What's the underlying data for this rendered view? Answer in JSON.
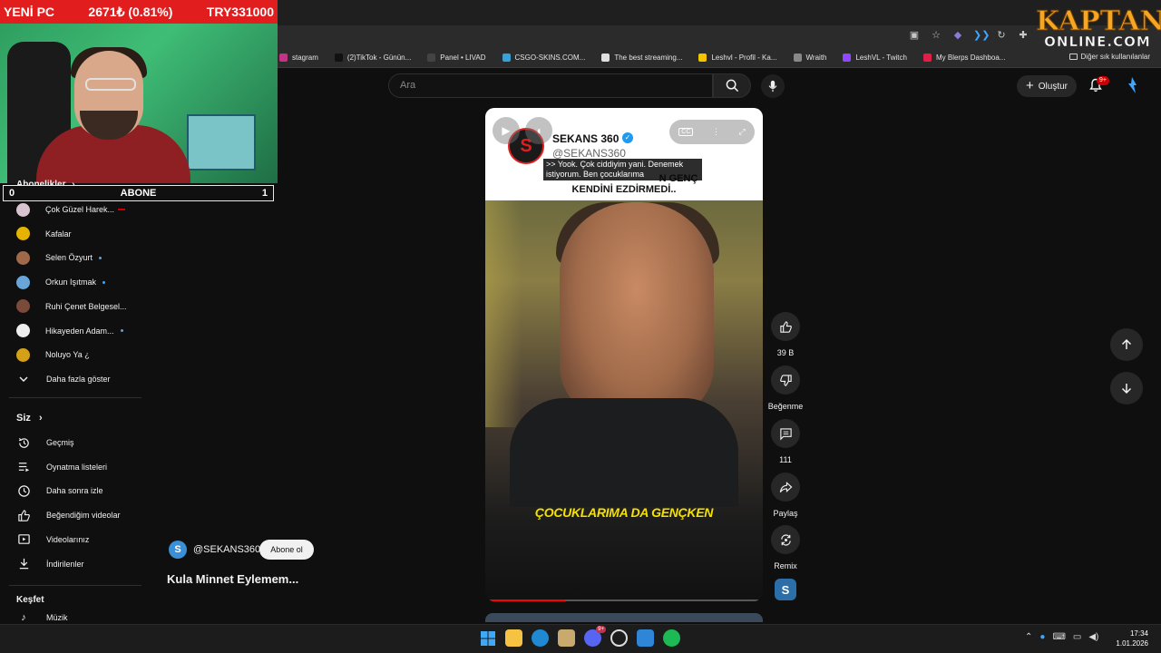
{
  "overlay": {
    "title": "YENİ PC",
    "price": "2671₺ (0.81%)",
    "goal": "TRY331000",
    "subs_left": "0",
    "subs_label": "ABONE",
    "subs_right": "1"
  },
  "bookmarks": [
    {
      "label": "stagram",
      "color": "#c13584"
    },
    {
      "label": "(2)TikTok - Günün...",
      "color": "#111111"
    },
    {
      "label": "Panel • LIVAD",
      "color": "#444444"
    },
    {
      "label": "CSGO-SKINS.COM...",
      "color": "#3aa0d8"
    },
    {
      "label": "The best streaming...",
      "color": "#e0e0e0"
    },
    {
      "label": "Leshvl - Profil - Ka...",
      "color": "#f5c400"
    },
    {
      "label": "Wraith",
      "color": "#888888"
    },
    {
      "label": "LeshVL - Twitch",
      "color": "#9146ff"
    },
    {
      "label": "My Blerps Dashboa...",
      "color": "#e11d48"
    }
  ],
  "bookmarks_other": "Diğer sık kullanılanlar",
  "brand": {
    "line1": "KAPTAN",
    "line2": "ONLINE.COM"
  },
  "search": {
    "placeholder": "Ara"
  },
  "create_label": "Oluştur",
  "bell_badge": "9+",
  "sidebar": {
    "subs_header": "Abonelikler",
    "channels": [
      {
        "label": "Çok Güzel Harek...",
        "color": "#d7c4d0",
        "indicator": "live"
      },
      {
        "label": "Kafalar",
        "color": "#e5b400",
        "indicator": "none"
      },
      {
        "label": "Selen Özyurt",
        "color": "#a06a4a",
        "indicator": "dot"
      },
      {
        "label": "Orkun Işıtmak",
        "color": "#6aa5d8",
        "indicator": "dot"
      },
      {
        "label": "Ruhi Çenet Belgesel...",
        "color": "#7a4a3a",
        "indicator": "none"
      },
      {
        "label": "Hikayeden Adam...",
        "color": "#eeeeee",
        "indicator": "dot"
      },
      {
        "label": "Noluyo Ya ¿",
        "color": "#d4a017",
        "indicator": "none"
      }
    ],
    "show_more": "Daha fazla göster",
    "you_header": "Siz",
    "you_items": [
      {
        "label": "Geçmiş",
        "icon": "history-icon"
      },
      {
        "label": "Oynatma listeleri",
        "icon": "playlist-icon"
      },
      {
        "label": "Daha sonra izle",
        "icon": "clock-icon"
      },
      {
        "label": "Beğendiğim videolar",
        "icon": "thumbs-up-icon"
      },
      {
        "label": "Videolarınız",
        "icon": "video-icon"
      },
      {
        "label": "İndirilenler",
        "icon": "download-icon"
      }
    ],
    "explore_header": "Keşfet",
    "explore_first": "Müzik"
  },
  "short": {
    "channel_name": "SEKANS 360",
    "channel_handle": "@SEKANS360",
    "caption_line1": ">> Yook. Çok ciddiyim yani. Denemek",
    "caption_line2": "istiyorum. Ben çocuklarıma",
    "headline_1": "N GENÇ",
    "headline_2": "KENDİNİ EZDİRMEDİ..",
    "subtitle": "ÇOCUKLARIMA DA GENÇKEN",
    "progress": 0.28,
    "author": "@SEKANS360",
    "subscribe": "Abone ol",
    "title": "Kula Minnet Eylemem..."
  },
  "actions": {
    "likes": "39 B",
    "dislike": "Beğenme",
    "comments": "111",
    "share": "Paylaş",
    "remix": "Remix"
  },
  "clock": {
    "time": "17:34",
    "date": "1.01.2026"
  }
}
